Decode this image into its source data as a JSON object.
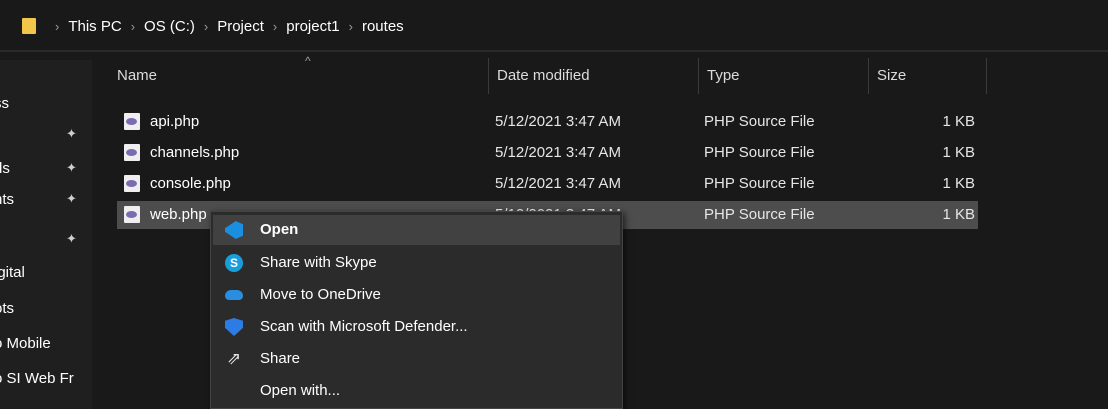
{
  "breadcrumb": {
    "items": [
      "This PC",
      "OS (C:)",
      "Project",
      "project1",
      "routes"
    ],
    "separator": "›"
  },
  "navpane": {
    "items": [
      {
        "label": "ss",
        "pinned": false
      },
      {
        "label": "",
        "pinned": true
      },
      {
        "label": "ds",
        "pinned": true
      },
      {
        "label": "nts",
        "pinned": true
      },
      {
        "label": "",
        "pinned": true
      },
      {
        "label": "igital",
        "pinned": false
      },
      {
        "label": "ots",
        "pinned": false
      },
      {
        "label": "o Mobile",
        "pinned": false
      },
      {
        "label": "o SI Web Fr",
        "pinned": false
      }
    ]
  },
  "columns": {
    "name": "Name",
    "date": "Date modified",
    "type": "Type",
    "size": "Size"
  },
  "files": [
    {
      "name": "api.php",
      "date": "5/12/2021 3:47 AM",
      "type": "PHP Source File",
      "size": "1 KB"
    },
    {
      "name": "channels.php",
      "date": "5/12/2021 3:47 AM",
      "type": "PHP Source File",
      "size": "1 KB"
    },
    {
      "name": "console.php",
      "date": "5/12/2021 3:47 AM",
      "type": "PHP Source File",
      "size": "1 KB"
    },
    {
      "name": "web.php",
      "date": "5/12/2021 3:47 AM",
      "type": "PHP Source File",
      "size": "1 KB",
      "selected": true
    }
  ],
  "context_menu": {
    "items": [
      {
        "label": "Open",
        "icon": "vscode-icon",
        "bold": true
      },
      {
        "label": "Share with Skype",
        "icon": "skype-icon"
      },
      {
        "label": "Move to OneDrive",
        "icon": "onedrive-icon"
      },
      {
        "label": "Scan with Microsoft Defender...",
        "icon": "defender-icon"
      },
      {
        "label": "Share",
        "icon": "share-icon"
      },
      {
        "label": "Open with...",
        "icon": ""
      }
    ]
  },
  "colors": {
    "background": "#191919",
    "selected_row": "#4d4d4d",
    "menu_bg": "#2b2b2b",
    "folder": "#f2c649"
  }
}
